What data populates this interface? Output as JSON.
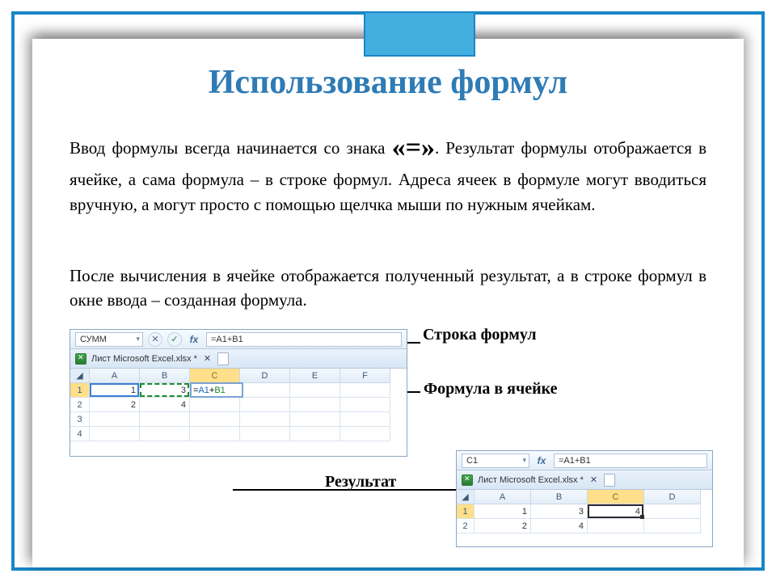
{
  "title": "Использование формул",
  "paragraph1_a": "Ввод формулы всегда начинается со знака ",
  "equals_sign": "«=»",
  "paragraph1_b": ". Результат формулы отображается в ячейке, а сама формула – в строке формул. Адреса ячеек в формуле могут вводиться вручную, а могут просто с помощью щелчка мыши по нужным ячейкам.",
  "paragraph2": "После вычисления в ячейке отображается полученный результат, а в строке формул в окне ввода – созданная формула.",
  "callouts": {
    "formula_bar": "Строка формул",
    "cell_formula": "Формула в ячейке",
    "result": "Результат"
  },
  "excel1": {
    "namebox": "СУММ",
    "cancel": "✕",
    "confirm": "✓",
    "fx": "fx",
    "formula": "=A1+B1",
    "tab_label": "Лист Microsoft Excel.xlsx *",
    "tab_close": "✕",
    "columns": [
      "A",
      "B",
      "C",
      "D",
      "E",
      "F"
    ],
    "rows": [
      "1",
      "2",
      "3",
      "4"
    ],
    "data": {
      "A1": "1",
      "B1": "3",
      "A2": "2",
      "B2": "4"
    },
    "editing_cell": {
      "eq": "=",
      "a1": "A1",
      "plus": "+",
      "b1": "B1"
    }
  },
  "excel2": {
    "namebox": "C1",
    "fx": "fx",
    "formula": "=A1+B1",
    "tab_label": "Лист Microsoft Excel.xlsx *",
    "tab_close": "✕",
    "columns": [
      "A",
      "B",
      "C",
      "D"
    ],
    "rows": [
      "1",
      "2"
    ],
    "data": {
      "A1": "1",
      "B1": "3",
      "C1": "4",
      "A2": "2",
      "B2": "4"
    }
  }
}
